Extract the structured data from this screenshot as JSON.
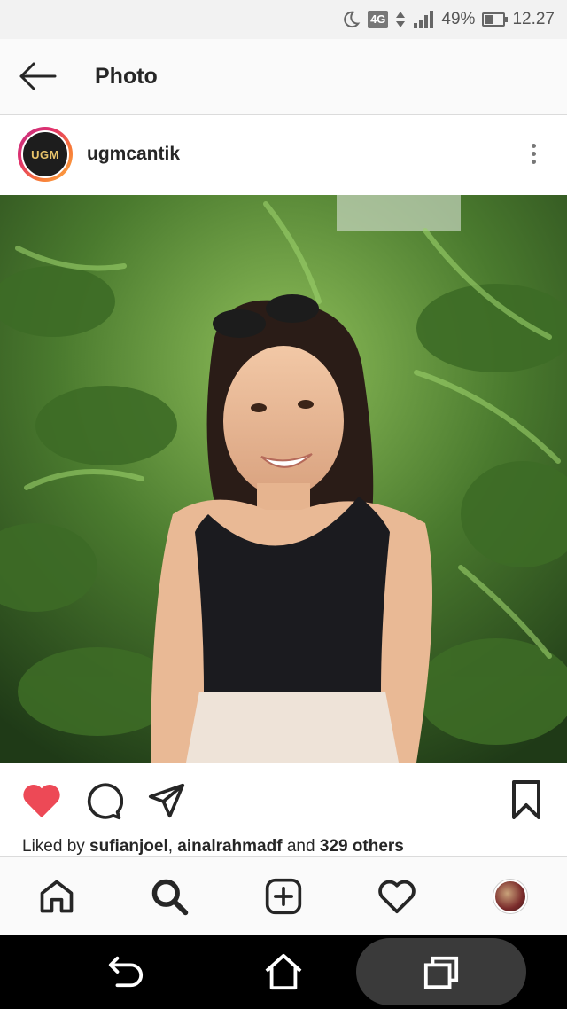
{
  "status_bar": {
    "network": "4G",
    "battery": "49%",
    "battery_level": 0.49,
    "time": "12.27",
    "icons": [
      "moon-icon",
      "data-arrows-icon",
      "signal-icon",
      "battery-icon"
    ]
  },
  "header": {
    "title": "Photo",
    "back_icon": "arrow-left-icon"
  },
  "post": {
    "username": "ugmcantik",
    "avatar_text": "UGM",
    "more_icon": "more-vertical-icon",
    "likes": {
      "prefix": "Liked by ",
      "user1": "sufianjoel",
      "separator": ", ",
      "user2": "ainalrahmadf",
      "conjunction": " and ",
      "others": "329 others"
    },
    "actions": [
      "heart-filled-icon",
      "comment-icon",
      "share-icon",
      "bookmark-icon"
    ],
    "like_color": "#ed4956"
  },
  "bottom_nav": [
    "home-icon",
    "search-icon",
    "add-icon",
    "heart-icon",
    "profile-avatar"
  ],
  "system_nav": [
    "back-icon",
    "home-icon",
    "recents-icon"
  ]
}
